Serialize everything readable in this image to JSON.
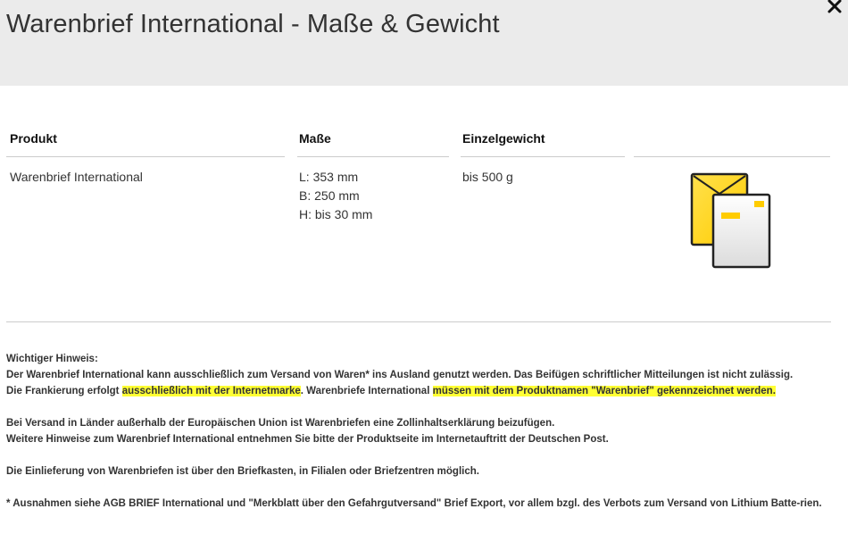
{
  "dialog": {
    "title": "Warenbrief International - Maße & Gewicht"
  },
  "table": {
    "headers": {
      "product": "Produkt",
      "dimensions": "Maße",
      "weight": "Einzelgewicht"
    },
    "row": {
      "product": "Warenbrief International",
      "length": "L: 353 mm",
      "width": "B: 250 mm",
      "height": "H: bis 30 mm",
      "weight": "bis 500 g",
      "icon": "envelope-product-icon"
    }
  },
  "notes": {
    "heading": "Wichtiger Hinweis:",
    "line1": "Der Warenbrief International kann ausschließlich zum Versand von Waren* ins Ausland genutzt werden. Das Beifügen schriftlicher Mitteilungen ist nicht zulässig.",
    "line2_a": "Die Frankierung erfolgt ",
    "line2_hl1": "ausschließlich mit der Internetmarke",
    "line2_b": ". Warenbriefe International ",
    "line2_hl2": "müssen mit dem Produktnamen \"Warenbrief\" gekennzeichnet werden.",
    "para2_line1": "Bei Versand in Länder außerhalb der Europäischen Union ist Warenbriefen eine Zollinhaltserklärung beizufügen.",
    "para2_line2": "Weitere Hinweise zum Warenbrief International entnehmen Sie bitte der Produktseite im Internetauftritt der Deutschen Post.",
    "para3": "Die Einlieferung von Warenbriefen ist über den Briefkasten, in Filialen oder Briefzentren möglich.",
    "para4": "* Ausnahmen siehe AGB BRIEF International und \"Merkblatt über den Gefahrgutversand\" Brief Export, vor allem bzgl. des Verbots zum Versand von Lithium Batte-rien."
  },
  "colors": {
    "header_bg": "#ebebeb",
    "highlight": "#ffff33",
    "envelope_yellow": "#ffcc00"
  }
}
